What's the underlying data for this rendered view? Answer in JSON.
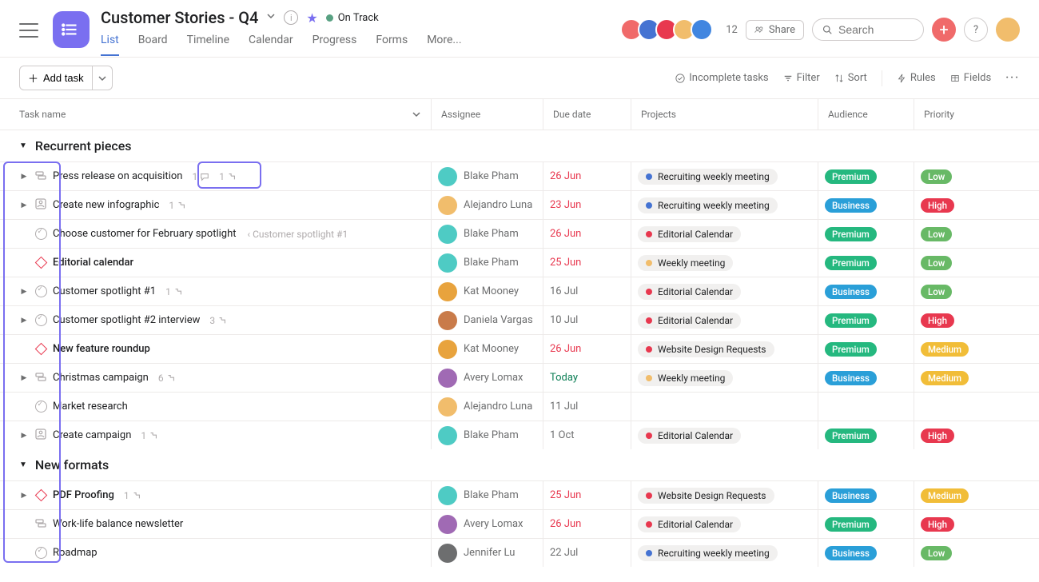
{
  "header": {
    "project_title": "Customer Stories - Q4",
    "status_label": "On Track",
    "tabs": [
      "List",
      "Board",
      "Timeline",
      "Calendar",
      "Progress",
      "Forms",
      "More..."
    ],
    "active_tab_index": 0,
    "member_count": "12",
    "share_label": "Share",
    "search_placeholder": "Search"
  },
  "toolbar": {
    "add_task_label": "Add task",
    "incomplete_label": "Incomplete tasks",
    "filter_label": "Filter",
    "sort_label": "Sort",
    "rules_label": "Rules",
    "fields_label": "Fields"
  },
  "columns": {
    "task": "Task name",
    "assignee": "Assignee",
    "due": "Due date",
    "projects": "Projects",
    "audience": "Audience",
    "priority": "Priority"
  },
  "avatar_colors": [
    "#f06a6a",
    "#4573d2",
    "#e8384f",
    "#f1bd6c",
    "#4186e0",
    "#aa62e3"
  ],
  "user_avatar_color": "#f1bd6c",
  "sections": [
    {
      "name": "Recurrent pieces",
      "tasks": [
        {
          "icon": "milestone",
          "expand": true,
          "name": "Press release on acquisition",
          "comments": "1",
          "subtasks": "1",
          "assignee": "Blake Pham",
          "av": "#4ecbc4",
          "due": "26 Jun",
          "due_style": "overdue",
          "project": {
            "label": "Recruiting weekly meeting",
            "dot": "#4573d2"
          },
          "audience": {
            "label": "Premium",
            "color": "#25b87f"
          },
          "priority": {
            "label": "Low",
            "color": "#68b966"
          }
        },
        {
          "icon": "approval",
          "expand": true,
          "name": "Create new infographic",
          "subtasks": "1",
          "assignee": "Alejandro Luna",
          "av": "#f1bd6c",
          "due": "23 Jun",
          "due_style": "overdue",
          "project": {
            "label": "Recruiting weekly meeting",
            "dot": "#4573d2"
          },
          "audience": {
            "label": "Business",
            "color": "#2a9fd8"
          },
          "priority": {
            "label": "High",
            "color": "#e8384f"
          }
        },
        {
          "icon": "check",
          "name": "Choose customer for February spotlight",
          "context": "‹  Customer spotlight #1",
          "assignee": "Blake Pham",
          "av": "#4ecbc4",
          "due": "26 Jun",
          "due_style": "overdue",
          "project": {
            "label": "Editorial Calendar",
            "dot": "#e8384f"
          },
          "audience": {
            "label": "Premium",
            "color": "#25b87f"
          },
          "priority": {
            "label": "Low",
            "color": "#68b966"
          }
        },
        {
          "icon": "diamond",
          "name": "Editorial calendar",
          "bold": true,
          "assignee": "Blake Pham",
          "av": "#4ecbc4",
          "due": "25 Jun",
          "due_style": "overdue",
          "project": {
            "label": "Weekly meeting",
            "dot": "#f1bd6c"
          },
          "audience": {
            "label": "Premium",
            "color": "#25b87f"
          },
          "priority": {
            "label": "Low",
            "color": "#68b966"
          }
        },
        {
          "icon": "check",
          "expand": true,
          "name": "Customer spotlight #1",
          "subtasks": "1",
          "assignee": "Kat Mooney",
          "av": "#e8a33d",
          "due": "16 Jul",
          "due_style": "normal",
          "project": {
            "label": "Editorial Calendar",
            "dot": "#e8384f"
          },
          "audience": {
            "label": "Business",
            "color": "#2a9fd8"
          },
          "priority": {
            "label": "Low",
            "color": "#68b966"
          }
        },
        {
          "icon": "check",
          "expand": true,
          "name": "Customer spotlight #2 interview",
          "subtasks": "3",
          "assignee": "Daniela Vargas",
          "av": "#c97b4a",
          "due": "10 Jul",
          "due_style": "normal",
          "project": {
            "label": "Editorial Calendar",
            "dot": "#e8384f"
          },
          "audience": {
            "label": "Premium",
            "color": "#25b87f"
          },
          "priority": {
            "label": "High",
            "color": "#e8384f"
          }
        },
        {
          "icon": "diamond",
          "name": "New feature roundup",
          "bold": true,
          "assignee": "Kat Mooney",
          "av": "#e8a33d",
          "due": "26 Jun",
          "due_style": "overdue",
          "project": {
            "label": "Website Design Requests",
            "dot": "#e8384f"
          },
          "audience": {
            "label": "Premium",
            "color": "#25b87f"
          },
          "priority": {
            "label": "Medium",
            "color": "#f1bd38"
          }
        },
        {
          "icon": "milestone",
          "expand": true,
          "name": "Christmas campaign",
          "subtasks": "6",
          "assignee": "Avery Lomax",
          "av": "#a06ab4",
          "due": "Today",
          "due_style": "today",
          "project": {
            "label": "Weekly meeting",
            "dot": "#f1bd6c"
          },
          "audience": {
            "label": "Business",
            "color": "#2a9fd8"
          },
          "priority": {
            "label": "Medium",
            "color": "#f1bd38"
          }
        },
        {
          "icon": "check",
          "name": "Market research",
          "assignee": "Alejandro Luna",
          "av": "#f1bd6c",
          "due": "11 Jul",
          "due_style": "normal"
        },
        {
          "icon": "approval",
          "expand": true,
          "name": "Create campaign",
          "subtasks": "1",
          "assignee": "Blake Pham",
          "av": "#4ecbc4",
          "due": "1 Oct",
          "due_style": "normal",
          "project": {
            "label": "Editorial Calendar",
            "dot": "#e8384f"
          },
          "audience": {
            "label": "Premium",
            "color": "#25b87f"
          },
          "priority": {
            "label": "High",
            "color": "#e8384f"
          }
        }
      ]
    },
    {
      "name": "New formats",
      "tasks": [
        {
          "icon": "diamond",
          "expand": true,
          "name": "PDF Proofing",
          "bold": true,
          "subtasks": "1",
          "assignee": "Blake Pham",
          "av": "#4ecbc4",
          "due": "25 Jun",
          "due_style": "overdue",
          "project": {
            "label": "Website Design Requests",
            "dot": "#e8384f"
          },
          "audience": {
            "label": "Business",
            "color": "#2a9fd8"
          },
          "priority": {
            "label": "Medium",
            "color": "#f1bd38"
          }
        },
        {
          "icon": "milestone",
          "name": "Work-life balance newsletter",
          "assignee": "Avery Lomax",
          "av": "#a06ab4",
          "due": "26 Jun",
          "due_style": "overdue",
          "project": {
            "label": "Editorial Calendar",
            "dot": "#e8384f"
          },
          "audience": {
            "label": "Premium",
            "color": "#25b87f"
          },
          "priority": {
            "label": "High",
            "color": "#e8384f"
          }
        },
        {
          "icon": "check",
          "name": "Roadmap",
          "assignee": "Jennifer Lu",
          "av": "#6d6e6f",
          "due": "22 Jul",
          "due_style": "normal",
          "project": {
            "label": "Recruiting weekly meeting",
            "dot": "#4573d2"
          },
          "audience": {
            "label": "Business",
            "color": "#2a9fd8"
          },
          "priority": {
            "label": "Low",
            "color": "#68b966"
          }
        }
      ]
    }
  ]
}
